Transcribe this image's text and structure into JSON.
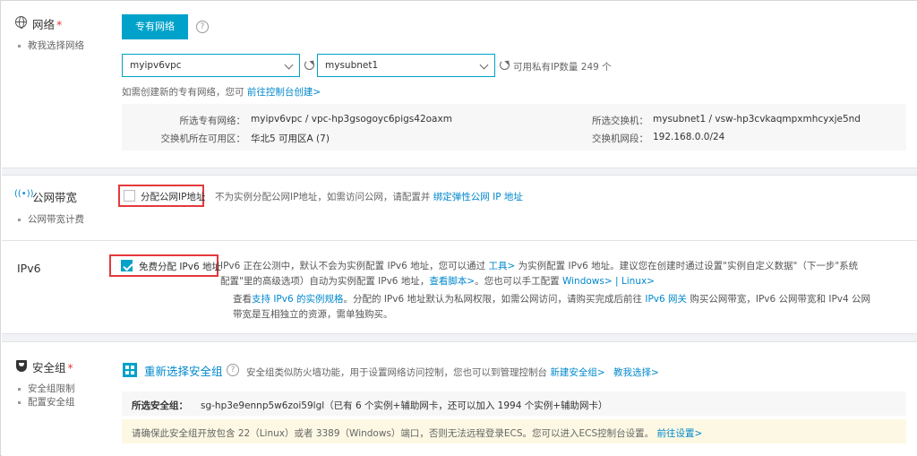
{
  "network": {
    "title": "网络",
    "required_mark": "*",
    "help_link": "教我选择网络",
    "vpc_button": "专有网络",
    "help_icon": "question-circle-icon",
    "vpc_select_value": "myipv6vpc",
    "subnet_select_value": "mysubnet1",
    "available_ips": "可用私有IP数量 249 个",
    "create_hint": "如需创建新的专有网络，您可",
    "create_link": "前往控制台创建>",
    "info": {
      "vpc_label": "所选专有网络：",
      "vpc_value": "myipv6vpc / vpc-hp3gsogoyc6pigs42oaxm",
      "zone_label": "交换机所在可用区：",
      "zone_value": "华北5 可用区A (7)",
      "vsw_label": "所选交换机：",
      "vsw_value": "mysubnet1 / vsw-hp3cvkaqmpxmhcyxje5nd",
      "cidr_label": "交换机网段：",
      "cidr_value": "192.168.0.0/24"
    }
  },
  "bandwidth": {
    "title": "公网带宽",
    "help_link": "公网带宽计费",
    "checkbox_label": "分配公网IP地址",
    "checked": false,
    "hint": "不为实例分配公网IP地址，如需访问公网，请配置并",
    "hint_link": "绑定弹性公网 IP 地址"
  },
  "ipv6": {
    "title": "IPv6",
    "checkbox_label": "免费分配 IPv6 地址",
    "checked": true,
    "p1_a": "IPv6 正在公测中，默认不会为实例配置 IPv6 地址，您可以通过",
    "p1_link": "工具>",
    "p1_b": "为实例配置 IPv6 地址。建议您在创建时通过设置\"实例自定义数据\"（下一步\"系统",
    "p2_a": "配置\"里的高级选项）自动为实例配置 IPv6 地址，",
    "p2_link1": "查看脚本>",
    "p2_b": "。您也可以手工配置",
    "p2_link2": "Windows>",
    "p2_sep": "|",
    "p2_link3": "Linux>",
    "p3_a": "查看",
    "p3_link1": "支持 IPv6 的实例规格",
    "p3_b": "。分配的 IPv6 地址默认为私网权限，如需公网访问，请购买完成后前往",
    "p3_link2": "IPv6 网关",
    "p3_c": "购买公网带宽，IPv6 公网带宽和 IPv4 公网",
    "p4": "带宽是互相独立的资源，需单独购买。"
  },
  "security_group": {
    "title": "安全组",
    "required_mark": "*",
    "links": [
      "安全组限制",
      "配置安全组"
    ],
    "reselect": "重新选择安全组",
    "desc": "安全组类似防火墙功能，用于设置网络访问控制，您也可以到管理控制台",
    "new_link": "新建安全组>",
    "teach_link": "教我选择>",
    "selected_label": "所选安全组：",
    "selected_value": "sg-hp3e9ennp5w6zoi59lgl（已有 6 个实例+辅助网卡，还可以加入 1994 个实例+辅助网卡）",
    "warning": "请确保此安全组开放包含 22（Linux）或者 3389（Windows）端口，否则无法远程登录ECS。您可以进入ECS控制台设置。",
    "warning_link": "前往设置>"
  }
}
